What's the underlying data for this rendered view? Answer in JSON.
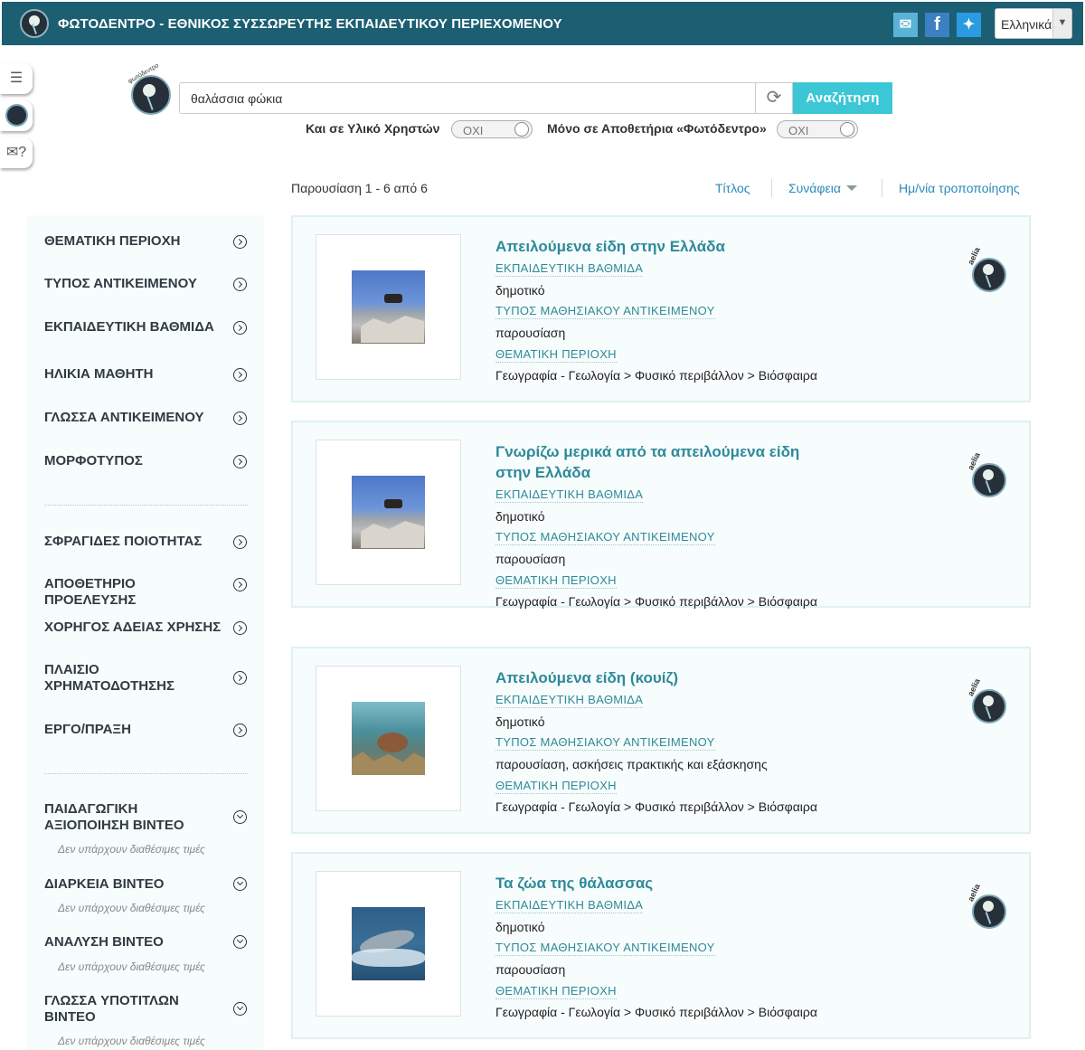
{
  "header": {
    "title": "ΦΩΤΟΔΕΝΤΡΟ - ΕΘΝΙΚΟΣ ΣΥΣΣΩΡΕΥΤΗΣ ΕΚΠΑΙΔΕΥΤΙΚΟΥ ΠΕΡΙΕΧΟΜΕΝΟΥ",
    "social": {
      "mail_icon": "envelope-icon",
      "fb_glyph": "f",
      "tw_glyph": "🐦"
    },
    "language": "Ελληνικά"
  },
  "side_tabs": [
    "notes-icon",
    "photodentro-icon",
    "help-mail-icon"
  ],
  "search": {
    "logo_text": "φωτόδεντρο",
    "query": "θαλάσσια φώκια",
    "button": "Αναζήτηση",
    "filter_users_label": "Και σε Υλικό Χρηστών",
    "filter_users_value": "ΟΧΙ",
    "filter_repo_label": "Μόνο σε Αποθετήρια «Φωτόδεντρο»",
    "filter_repo_value": "ΟΧΙ"
  },
  "results_header": {
    "count": "Παρουσίαση 1 - 6 από 6",
    "sort_title": "Τίτλος",
    "sort_relevance": "Συνάφεια",
    "sort_modified": "Ημ/νία τροποποίησης"
  },
  "sidebar": {
    "group1": [
      "ΘΕΜΑΤΙΚΗ ΠΕΡΙΟΧΗ",
      "ΤΥΠΟΣ ΑΝΤΙΚΕΙΜΕΝΟΥ",
      "ΕΚΠΑΙΔΕΥΤΙΚΗ ΒΑΘΜΙΔΑ",
      "ΗΛΙΚΙΑ ΜΑΘΗΤΗ",
      "ΓΛΩΣΣΑ ΑΝΤΙΚΕΙΜΕΝΟΥ",
      "ΜΟΡΦΟΤΥΠΟΣ"
    ],
    "group2": [
      "ΣΦΡΑΓΙΔΕΣ ΠΟΙΟΤΗΤΑΣ",
      "ΑΠΟΘΕΤΗΡΙΟ ΠΡΟΕΛΕΥΣΗΣ",
      "ΧΟΡΗΓΟΣ ΑΔΕΙΑΣ ΧΡΗΣΗΣ",
      "ΠΛΑΙΣΙΟ ΧΡΗΜΑΤΟΔΟΤΗΣΗΣ",
      "ΕΡΓΟ/ΠΡΑΞΗ"
    ],
    "group3": [
      "ΠΑΙΔΑΓΩΓΙΚΗ ΑΞΙΟΠΟΙΗΣΗ ΒΙΝΤΕΟ",
      "ΔΙΑΡΚΕΙΑ ΒΙΝΤΕΟ",
      "ΑΝΑΛΥΣΗ ΒΙΝΤΕΟ",
      "ΓΛΩΣΣΑ ΥΠΟΤΙΤΛΩΝ ΒΙΝΤΕΟ"
    ],
    "no_values": "Δεν υπάρχουν διαθέσιμες τιμές"
  },
  "results": [
    {
      "title": "Απειλούμενα είδη στην Ελλάδα",
      "level_label": "ΕΚΠΑΙΔΕΥΤΙΚΗ ΒΑΘΜΙΔΑ",
      "level": "δημοτικό",
      "type_label": "ΤΥΠΟΣ ΜΑΘΗΣΙΑΚΟΥ ΑΝΤΙΚΕΙΜΕΝΟΥ",
      "type": "παρουσίαση",
      "subject_label": "ΘΕΜΑΤΙΚΗ ΠΕΡΙΟΧΗ",
      "subject": "Γεωγραφία - Γεωλογία > Φυσικό περιβάλλον > Βιόσφαιρα",
      "badge": "aelia",
      "thumb": "goat-photo"
    },
    {
      "title": "Γνωρίζω μερικά από τα απειλούμενα είδη στην Ελλάδα",
      "level_label": "ΕΚΠΑΙΔΕΥΤΙΚΗ ΒΑΘΜΙΔΑ",
      "level": "δημοτικό",
      "type_label": "ΤΥΠΟΣ ΜΑΘΗΣΙΑΚΟΥ ΑΝΤΙΚΕΙΜΕΝΟΥ",
      "type": "παρουσίαση",
      "subject_label": "ΘΕΜΑΤΙΚΗ ΠΕΡΙΟΧΗ",
      "subject": "Γεωγραφία - Γεωλογία > Φυσικό περιβάλλον > Βιόσφαιρα",
      "badge": "aelia",
      "thumb": "goat-photo"
    },
    {
      "title": "Απειλούμενα είδη (κουίζ)",
      "level_label": "ΕΚΠΑΙΔΕΥΤΙΚΗ ΒΑΘΜΙΔΑ",
      "level": "δημοτικό",
      "type_label": "ΤΥΠΟΣ ΜΑΘΗΣΙΑΚΟΥ ΑΝΤΙΚΕΙΜΕΝΟΥ",
      "type": "παρουσίαση, ασκήσεις πρακτικής και εξάσκησης",
      "subject_label": "ΘΕΜΑΤΙΚΗ ΠΕΡΙΟΧΗ",
      "subject": "Γεωγραφία - Γεωλογία > Φυσικό περιβάλλον > Βιόσφαιρα",
      "badge": "aelia",
      "thumb": "turtle-photo"
    },
    {
      "title": "Τα ζώα της θάλασσας",
      "level_label": "ΕΚΠΑΙΔΕΥΤΙΚΗ ΒΑΘΜΙΔΑ",
      "level": "δημοτικό",
      "type_label": "ΤΥΠΟΣ ΜΑΘΗΣΙΑΚΟΥ ΑΝΤΙΚΕΙΜΕΝΟΥ",
      "type": "παρουσίαση",
      "subject_label": "ΘΕΜΑΤΙΚΗ ΠΕΡΙΟΧΗ",
      "subject": "Γεωγραφία - Γεωλογία > Φυσικό περιβάλλον > Βιόσφαιρα",
      "badge": "aelia",
      "thumb": "dolphin-photo"
    }
  ],
  "colors": {
    "header": "#1c5e72",
    "accent": "#3cc7d6",
    "title": "#2d8a9a",
    "link": "#2a8ab5"
  }
}
